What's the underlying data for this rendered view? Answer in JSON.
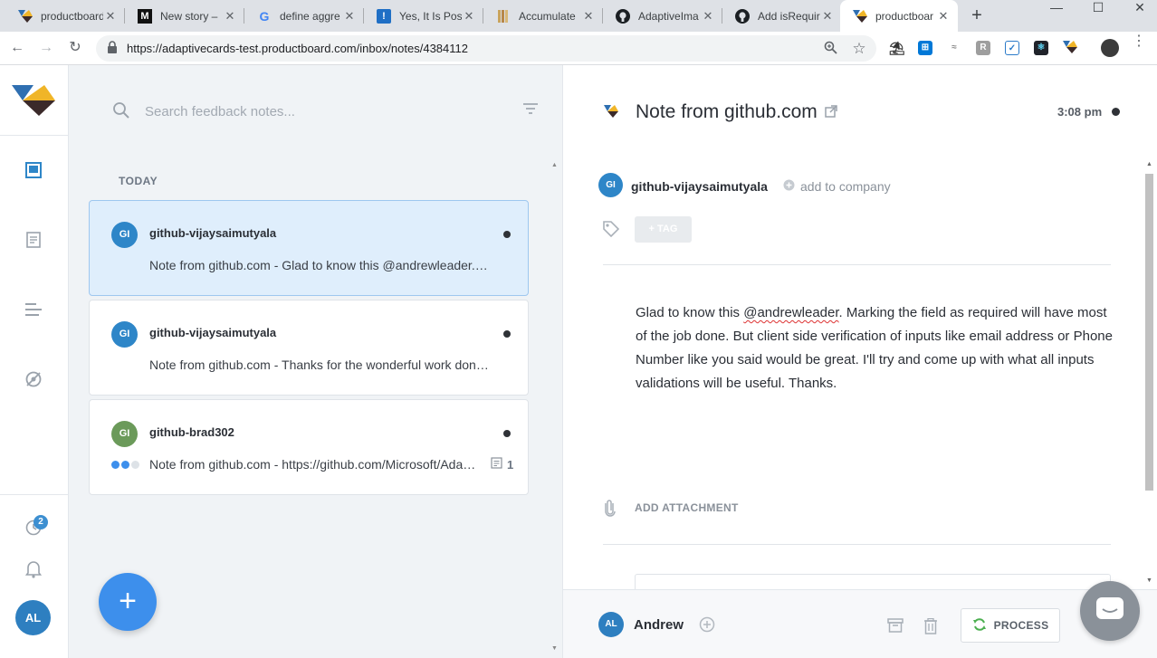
{
  "browser": {
    "tabs": [
      {
        "label": "productboard",
        "favicon": "productboard-icon"
      },
      {
        "label": "New story –",
        "favicon": "medium-icon",
        "favicon_text": "M"
      },
      {
        "label": "define aggre",
        "favicon": "google-icon",
        "favicon_text": "G"
      },
      {
        "label": "Yes, It Is Pos",
        "favicon": "exclamation-icon",
        "favicon_text": "!"
      },
      {
        "label": "Accumulate",
        "favicon": "book-icon"
      },
      {
        "label": "AdaptiveIma",
        "favicon": "github-icon"
      },
      {
        "label": "Add isRequir",
        "favicon": "github-icon"
      },
      {
        "label": "productboar",
        "favicon": "productboard-icon"
      }
    ],
    "url": "https://adaptivecards-test.productboard.com/inbox/notes/4384112"
  },
  "sidebar": {
    "badge_count": "2",
    "user_initials": "AL"
  },
  "notes": {
    "search_placeholder": "Search feedback notes...",
    "section_label": "TODAY",
    "items": [
      {
        "initials": "GI",
        "author": "github-vijaysaimutyala",
        "preview": "Note from github.com - Glad to know this @andrewleader. Marking the field as required will have most",
        "avatar_color": "#2e86c8"
      },
      {
        "initials": "GI",
        "author": "github-vijaysaimutyala",
        "preview": "Note from github.com - Thanks for the wonderful work done here",
        "avatar_color": "#2e86c8"
      },
      {
        "initials": "GI",
        "author": "github-brad302",
        "preview": "Note from github.com - https://github.com/Microsoft/AdaptiveCards",
        "avatar_color": "#6b9a5a",
        "insight_count": "1"
      }
    ]
  },
  "detail": {
    "title": "Note from github.com",
    "time": "3:08 pm",
    "author_initials": "GI",
    "author": "github-vijaysaimutyala",
    "add_company": "add to company",
    "tag_label": "TAG",
    "body_before": "Glad to know this ",
    "body_mention": "@andrewleader",
    "body_after": ". Marking the field as required will have most of the job done. But client side verification of inputs like email address or Phone Number like you said would be great. I'll try and come up with what all inputs validations will be useful. Thanks.",
    "attachment_label": "ADD ATTACHMENT",
    "footer_initials": "AL",
    "footer_user": "Andrew",
    "process_label": "PROCESS"
  }
}
